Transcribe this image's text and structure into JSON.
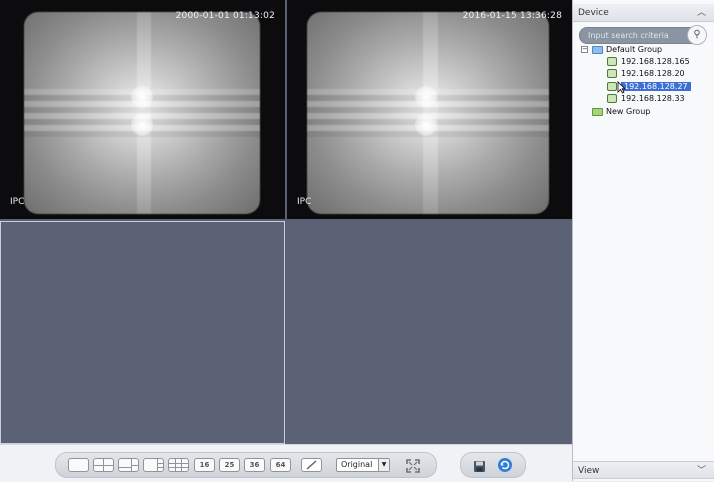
{
  "tiles": [
    {
      "timestamp": "2000-01-01 01:13:02",
      "label": "IPC"
    },
    {
      "timestamp": "2016-01-15 13:36:28",
      "label": "IPC"
    }
  ],
  "sidebar": {
    "device_header": "Device",
    "search_placeholder": "Input search criteria",
    "tree": {
      "default_group": "Default Group",
      "devices": [
        "192.168.128.165",
        "192.168.128.20",
        "192.168.128.27",
        "192.168.128.33"
      ],
      "selected_index": 2,
      "new_group": "New Group"
    },
    "view_header": "View"
  },
  "toolbar": {
    "split_labels": [
      "16",
      "25",
      "36",
      "64"
    ],
    "stream_mode": "Original"
  },
  "colors": {
    "accent": "#3d6fd6",
    "video_bg": "#5c6275"
  }
}
